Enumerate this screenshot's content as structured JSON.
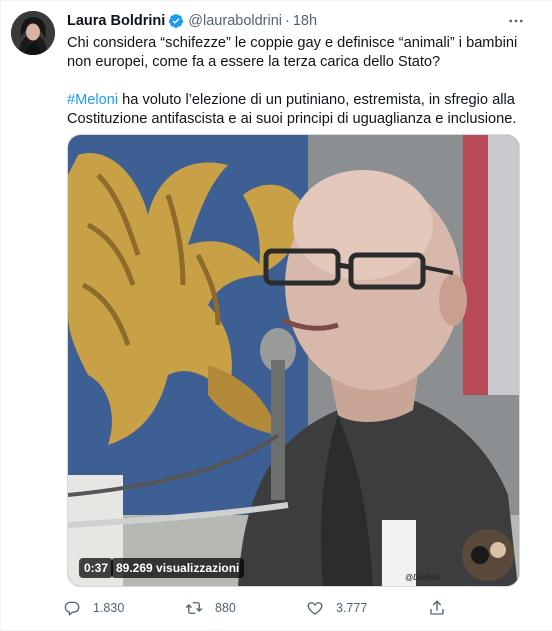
{
  "author": {
    "display_name": "Laura Boldrini",
    "handle": "@lauraboldrini",
    "separator": "·",
    "time": "18h",
    "verified_icon": "verified-badge-icon"
  },
  "tweet": {
    "line1": "Chi considera “schifezze” le coppie gay e definisce “animali” i bambini non europei, come fa a essere la terza carica dello Stato?",
    "hashtag": "#Meloni",
    "line2_rest": " ha voluto l’elezione di un putiniano, estremista, in sfregio alla Costituzione antifascista e ai suoi principi di uguaglianza e inclusione."
  },
  "media": {
    "duration": "0:37",
    "views": "89.269 visualizzazioni",
    "watermark": "@Darkdiv"
  },
  "actions": {
    "replies": "1.830",
    "retweets": "880",
    "likes": "3.777"
  },
  "colors": {
    "accent": "#1d9bf0",
    "text": "#0f1419",
    "secondary": "#536471"
  }
}
